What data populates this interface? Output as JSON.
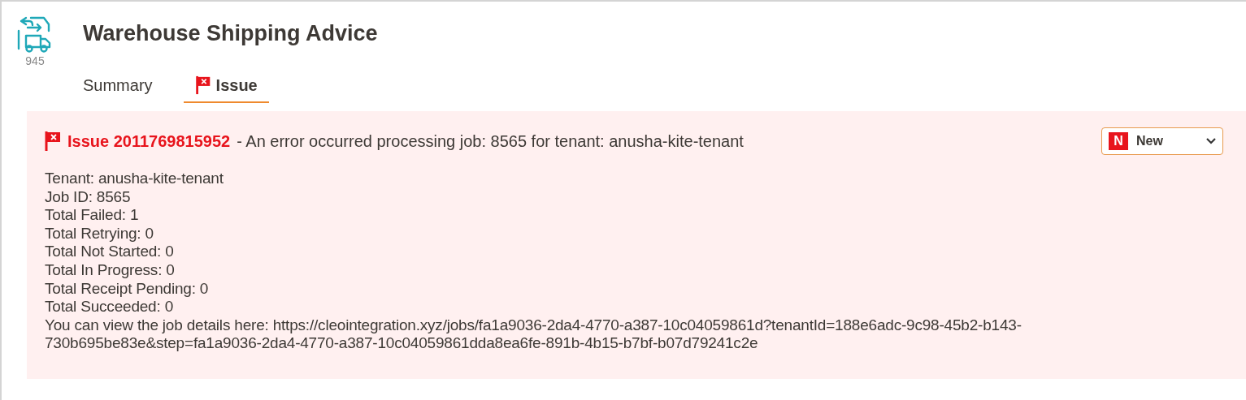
{
  "header": {
    "title": "Warehouse Shipping Advice",
    "code": "945"
  },
  "tabs": [
    {
      "label": "Summary",
      "selected": false,
      "flag": false
    },
    {
      "label": "Issue",
      "selected": true,
      "flag": true
    }
  ],
  "issue": {
    "id": "Issue 2011769815952",
    "message": "- An error occurred processing job: 8565 for tenant: anusha-kite-tenant",
    "status": {
      "badge": "N",
      "value": "New"
    },
    "lines": [
      "Tenant: anusha-kite-tenant",
      "Job ID: 8565",
      "Total Failed: 1",
      "Total Retrying: 0",
      "Total Not Started: 0",
      "Total In Progress: 0",
      "Total Receipt Pending: 0",
      "Total Succeeded: 0",
      "You can view the job details here: https://cleointegration.xyz/jobs/fa1a9036-2da4-4770-a387-10c04059861d?tenantId=188e6adc-9c98-45b2-b143-",
      "730b695be83e&step=fa1a9036-2da4-4770-a387-10c04059861dda8ea6fe-891b-4b15-b7bf-b07d79241c2e"
    ]
  }
}
